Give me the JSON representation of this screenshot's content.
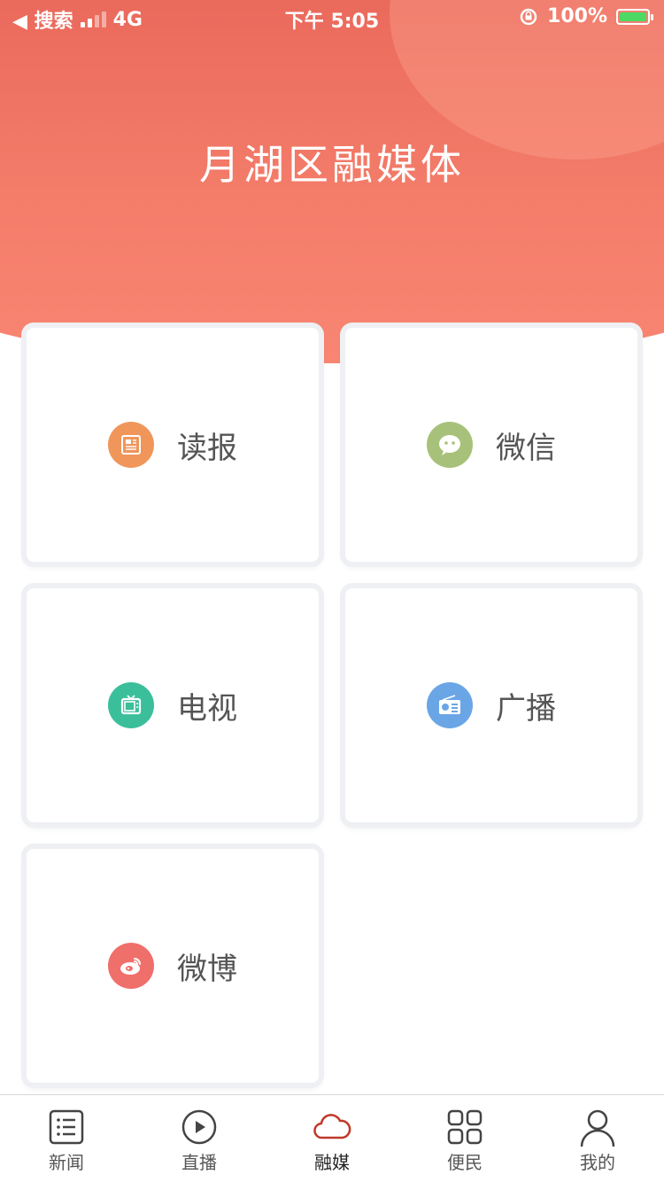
{
  "status_bar": {
    "back_label": "◀ 搜索",
    "network": "4G",
    "time": "下午 5:05",
    "battery": "100%"
  },
  "header": {
    "title": "月湖区融媒体"
  },
  "cards": [
    {
      "label": "读报",
      "icon": "newspaper-icon",
      "color": "#f0965a"
    },
    {
      "label": "微信",
      "icon": "wechat-icon",
      "color": "#a7c17a"
    },
    {
      "label": "电视",
      "icon": "tv-icon",
      "color": "#3bbf9b"
    },
    {
      "label": "广播",
      "icon": "radio-icon",
      "color": "#6aa6e6"
    },
    {
      "label": "微博",
      "icon": "weibo-icon",
      "color": "#ef6f6b"
    }
  ],
  "tab_bar": {
    "tabs": [
      {
        "label": "新闻",
        "icon": "list-icon",
        "active": false
      },
      {
        "label": "直播",
        "icon": "play-icon",
        "active": false
      },
      {
        "label": "融媒",
        "icon": "cloud-icon",
        "active": true
      },
      {
        "label": "便民",
        "icon": "grid-icon",
        "active": false
      },
      {
        "label": "我的",
        "icon": "user-icon",
        "active": false
      }
    ]
  },
  "colors": {
    "header_red": "#ea6a5c",
    "active_tab": "#c0392b"
  }
}
